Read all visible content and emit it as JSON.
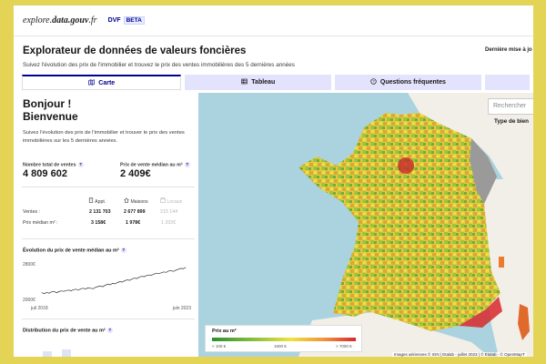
{
  "header": {
    "brand_light": "explore.",
    "brand_bold": "data.gouv",
    "brand_suffix": ".fr",
    "dvf": "DVF",
    "beta": "BETA"
  },
  "page": {
    "title": "Explorateur de données de valeurs foncières",
    "subtitle": "Suivez l'évolution des prix de l'immobilier et trouvez le prix des ventes immobilières des 5 dernières années",
    "last_update": "Dernière mise à jo"
  },
  "tabs": [
    {
      "label": "Carte",
      "icon": "map-icon"
    },
    {
      "label": "Tableau",
      "icon": "table-icon"
    },
    {
      "label": "Questions fréquentes",
      "icon": "question-icon"
    },
    {
      "label": "",
      "icon": ""
    }
  ],
  "left": {
    "greeting_1": "Bonjour !",
    "greeting_2": "Bienvenue",
    "intro": "Suivez l'évolution des prix de l'immobilier et trouver le prix des ventes immobilières sur les 5 dernières années.",
    "total_label": "Nombre total de ventes",
    "total_value": "4 809 602",
    "median_label": "Prix de vente médian au m²",
    "median_value": "2 409€",
    "table": {
      "col_appt": "Appt.",
      "col_maisons": "Maisons",
      "col_locaux": "Locaux",
      "row_ventes": "Ventes :",
      "row_prix": "Prix médian m² :",
      "ventes": [
        "2 131 703",
        "2 677 899",
        "215 144"
      ],
      "prix": [
        "3 158€",
        "1 978€",
        "1 333€"
      ]
    },
    "evolution_title": "Évolution du prix de vente médian au m²",
    "dist_title": "Distribution du prix de vente au m²"
  },
  "chart_data": {
    "type": "line",
    "title": "Évolution du prix de vente médian au m²",
    "y_tick_labels": [
      "2800€",
      "2000€"
    ],
    "x_tick_labels": [
      "juil 2018",
      "juin 2023"
    ],
    "ylim": [
      2000,
      2800
    ],
    "x": [
      "juil 2018",
      "août 2018",
      "sept 2018",
      "oct 2018",
      "nov 2018",
      "déc 2018",
      "janv 2019",
      "févr 2019",
      "mars 2019",
      "avr 2019",
      "mai 2019",
      "juin 2019",
      "juil 2019",
      "août 2019",
      "sept 2019",
      "oct 2019",
      "nov 2019",
      "déc 2019",
      "janv 2020",
      "févr 2020",
      "mars 2020",
      "avr 2020",
      "mai 2020",
      "juin 2020",
      "juil 2020",
      "août 2020",
      "sept 2020",
      "oct 2020",
      "nov 2020",
      "déc 2020",
      "janv 2021",
      "févr 2021",
      "mars 2021",
      "avr 2021",
      "mai 2021",
      "juin 2021",
      "juil 2021",
      "août 2021",
      "sept 2021",
      "oct 2021",
      "nov 2021",
      "déc 2021",
      "janv 2022",
      "févr 2022",
      "mars 2022",
      "avr 2022",
      "mai 2022",
      "juin 2022",
      "juil 2022",
      "août 2022",
      "sept 2022",
      "oct 2022",
      "nov 2022",
      "déc 2022",
      "janv 2023",
      "févr 2023",
      "mars 2023",
      "avr 2023",
      "mai 2023",
      "juin 2023"
    ],
    "series": [
      {
        "values": [
          2150,
          2130,
          2160,
          2140,
          2170,
          2180,
          2150,
          2175,
          2190,
          2180,
          2200,
          2210,
          2195,
          2220,
          2230,
          2210,
          2240,
          2250,
          2235,
          2260,
          2250,
          2240,
          2270,
          2290,
          2300,
          2285,
          2320,
          2340,
          2330,
          2360,
          2350,
          2380,
          2400,
          2390,
          2420,
          2440,
          2430,
          2460,
          2480,
          2470,
          2500,
          2520,
          2510,
          2540,
          2550,
          2545,
          2570,
          2590,
          2580,
          2600,
          2620,
          2610,
          2640,
          2650,
          2630,
          2660,
          2680,
          2700,
          2690,
          2720
        ]
      }
    ],
    "grid": false
  },
  "map": {
    "search_placeholder": "Rechercher",
    "type_label": "Type de bien",
    "legend_title": "Prix au m²",
    "legend_min": "< 100 €",
    "legend_mid": "1600 €",
    "legend_max": "> 7000 €",
    "attribution": "Images aériennes © IGN | Etalab - juillet 2023 | © Etalab · © OpenMapT",
    "colors": {
      "low": "#2d8f2b",
      "mid": "#f0e23e",
      "high": "#d8282c",
      "sea": "#aad3df",
      "neighbor": "#f2efe9"
    }
  }
}
